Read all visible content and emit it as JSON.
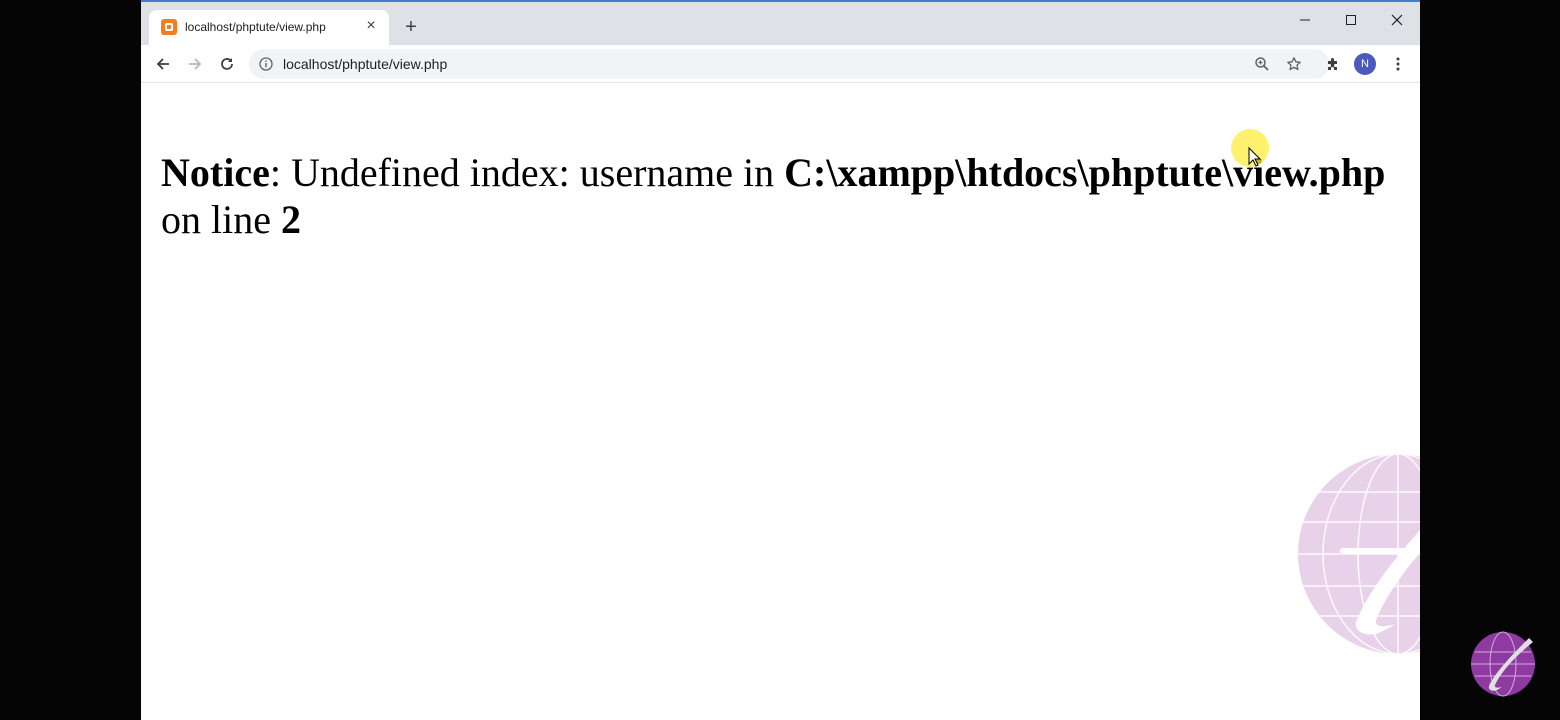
{
  "browser": {
    "tab": {
      "title": "localhost/phptute/view.php",
      "close_label": "×"
    },
    "new_tab_label": "+",
    "address_bar": {
      "url": "localhost/phptute/view.php"
    },
    "profile_initial": "N",
    "accent_color": "#3c7fd1"
  },
  "page": {
    "notice_label": "Notice",
    "notice_message": ": Undefined index: username in ",
    "file_path": "C:\\xampp\\htdocs\\phptute\\view.php",
    "line_prefix": " on line ",
    "line_number": "2"
  },
  "icons": {
    "tab_favicon": "xampp-icon",
    "back": "arrow-left-icon",
    "forward": "arrow-right-icon",
    "reload": "reload-icon",
    "site_info": "info-icon",
    "zoom": "zoom-icon",
    "bookmark": "star-icon",
    "extensions": "puzzle-icon",
    "menu": "kebab-menu-icon"
  }
}
